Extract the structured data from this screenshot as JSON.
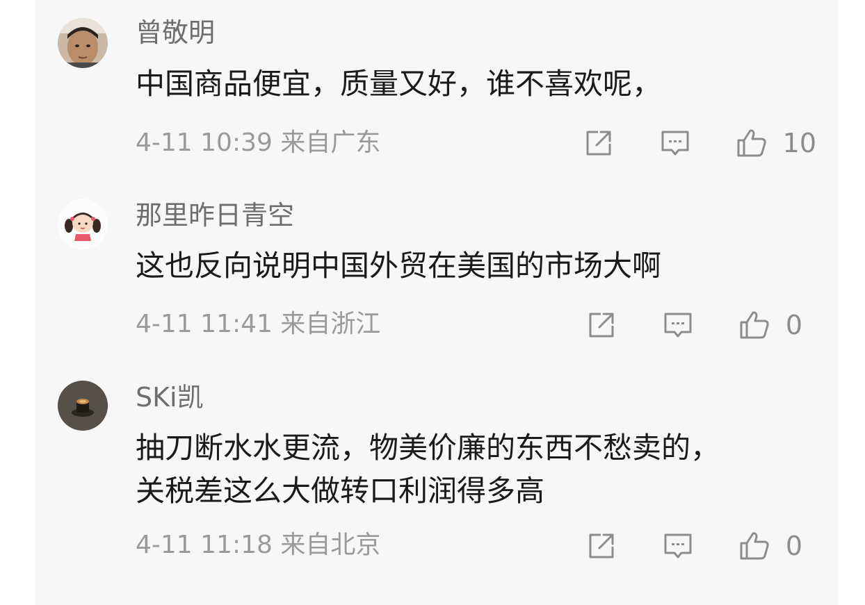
{
  "comments": [
    {
      "username": "曾敬明",
      "content": "中国商品便宜，质量又好，谁不喜欢呢，",
      "meta": "4-11 10:39 来自广东",
      "likes": "10",
      "avatar_icon": "man-photo-avatar"
    },
    {
      "username": "那里昨日青空",
      "content": "这也反向说明中国外贸在美国的市场大啊",
      "meta": "4-11 11:41 来自浙江",
      "likes": "0",
      "avatar_icon": "cartoon-girl-avatar"
    },
    {
      "username": "SKi凯",
      "content": "抽刀断水水更流，物美价廉的东西不愁卖的，\n关税差这么大做转口利润得多高",
      "meta": "4-11 11:18 来自北京",
      "likes": "0",
      "avatar_icon": "coffee-cup-avatar"
    }
  ],
  "icons": {
    "share": "share-icon",
    "reply": "comment-icon",
    "like": "thumbs-up-icon"
  },
  "colors": {
    "background": "#f7f7f7",
    "username": "#6e6e6e",
    "content": "#1a1a1a",
    "meta": "#9a9a9a",
    "icon": "#8c8c8c"
  }
}
